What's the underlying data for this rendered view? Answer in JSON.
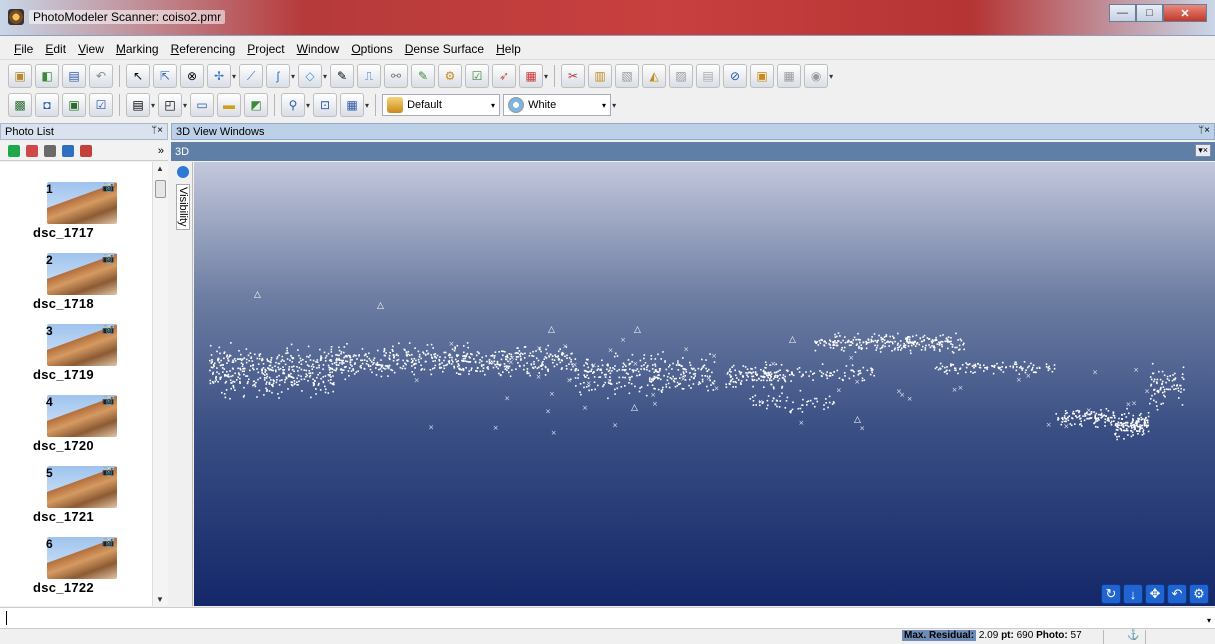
{
  "window": {
    "title": "PhotoModeler Scanner: coiso2.pmr",
    "buttons": {
      "minimize": "—",
      "maximize": "□",
      "close": "✕"
    }
  },
  "menu": [
    "File",
    "Edit",
    "View",
    "Marking",
    "Referencing",
    "Project",
    "Window",
    "Options",
    "Dense Surface",
    "Help"
  ],
  "toolbar": {
    "display_combo": "Default",
    "color_combo": "White"
  },
  "panels": {
    "photo_list_title": "Photo List",
    "view_windows_title": "3D View Windows",
    "view_tab": "3D",
    "pin_glyph": "ᛘ×",
    "visibility_label": "Visibility",
    "more_glyph": "»"
  },
  "photos": [
    {
      "number": "1",
      "name": "dsc_1717"
    },
    {
      "number": "2",
      "name": "dsc_1718"
    },
    {
      "number": "3",
      "name": "dsc_1719"
    },
    {
      "number": "4",
      "name": "dsc_1720"
    },
    {
      "number": "5",
      "name": "dsc_1721"
    },
    {
      "number": "6",
      "name": "dsc_1722"
    }
  ],
  "status": {
    "max_residual_label": "Max. Residual:",
    "max_residual_value": "2.09",
    "pt_label": "pt:",
    "pt_value": "690",
    "photo_label": "Photo:",
    "photo_value": "57"
  },
  "colors": {
    "view_top": "#c3c8dc",
    "view_bottom": "#142769",
    "point_color": "#ffffff",
    "nav_blue": "#1f64d1"
  }
}
